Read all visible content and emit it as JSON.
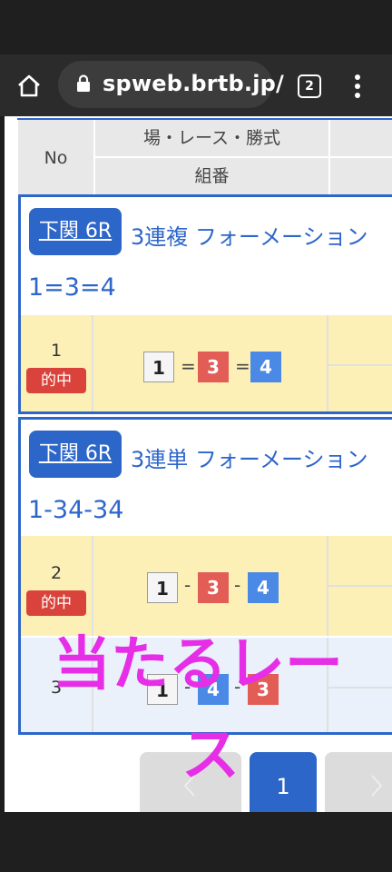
{
  "browser": {
    "url": "spweb.brtb.jp/",
    "tab_count": "2"
  },
  "table": {
    "header_no": "No",
    "header_race": "場・レース・勝式",
    "header_combo": "組番"
  },
  "cards": [
    {
      "venue_race": "下関 6R",
      "bet_type": "3連複 フォーメーション",
      "combination": "1=3=4",
      "rows": [
        {
          "no": "1",
          "hit": "的中",
          "numbers": [
            "1",
            "3",
            "4"
          ],
          "separator": "="
        }
      ]
    },
    {
      "venue_race": "下関 6R",
      "bet_type": "3連単 フォーメーション",
      "combination": "1-34-34",
      "rows": [
        {
          "no": "2",
          "hit": "的中",
          "numbers": [
            "1",
            "3",
            "4"
          ],
          "separator": "-"
        },
        {
          "no": "3",
          "hit": "",
          "numbers": [
            "1",
            "4",
            "3"
          ],
          "separator": "-"
        }
      ]
    }
  ],
  "pagination": {
    "current_page": "1"
  },
  "overlay": {
    "line1": "当たるレー",
    "line2": "ス"
  },
  "colors": {
    "accent": "#2d66c9",
    "hit": "#d9433b",
    "overlay": "#e62ee6"
  }
}
